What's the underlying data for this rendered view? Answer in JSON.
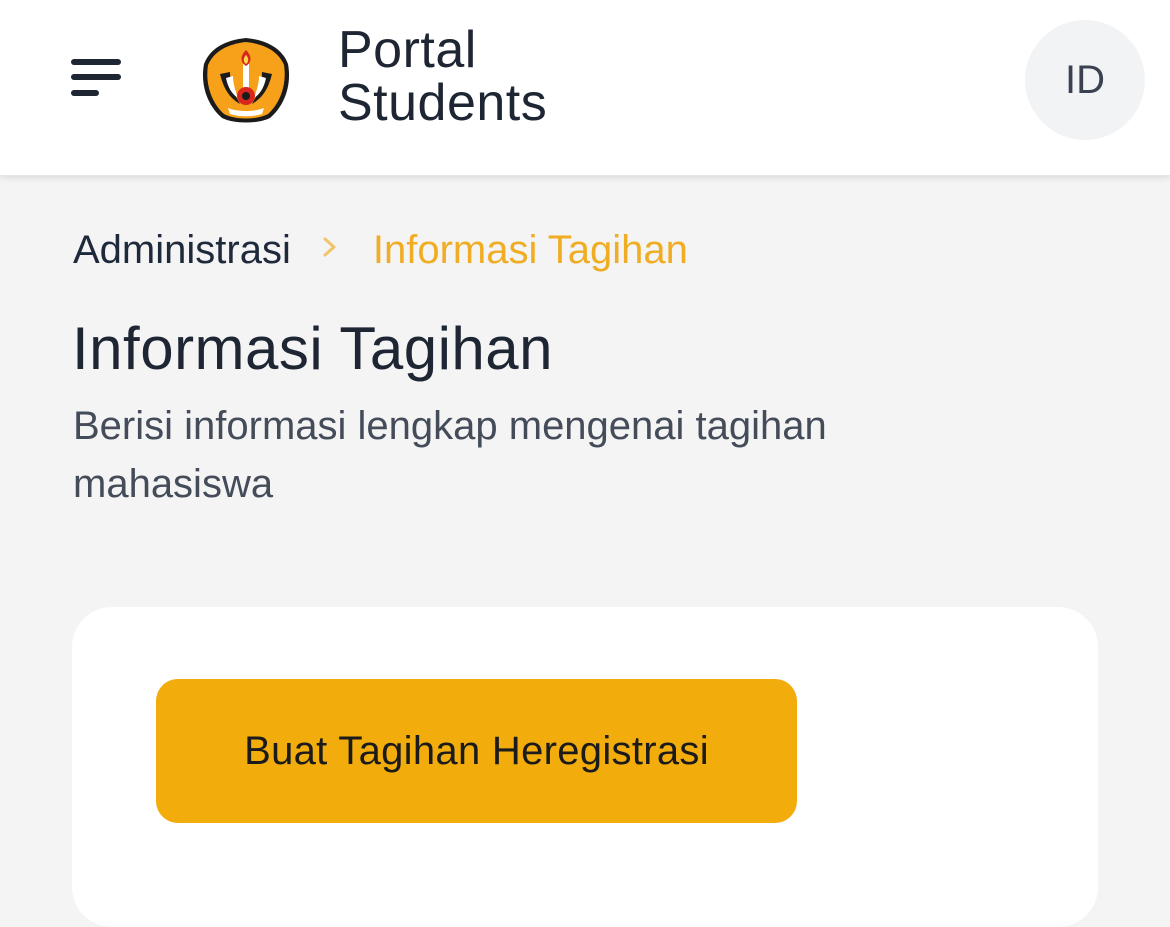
{
  "header": {
    "menu_icon": "hamburger-menu-icon",
    "logo_icon": "university-emblem-icon",
    "brand_line1": "Portal",
    "brand_line2": "Students",
    "language_button": "ID"
  },
  "breadcrumb": {
    "parent": "Administrasi",
    "separator_icon": "chevron-right-icon",
    "current": "Informasi Tagihan"
  },
  "page": {
    "title": "Informasi Tagihan",
    "subtitle": "Berisi informasi lengkap mengenai tagihan mahasiswa"
  },
  "card": {
    "primary_button": "Buat Tagihan Heregistrasi"
  },
  "colors": {
    "accent": "#f2ac0c",
    "breadcrumb_active": "#f0ad24",
    "text_primary": "#1e2533",
    "background": "#f4f4f5"
  }
}
